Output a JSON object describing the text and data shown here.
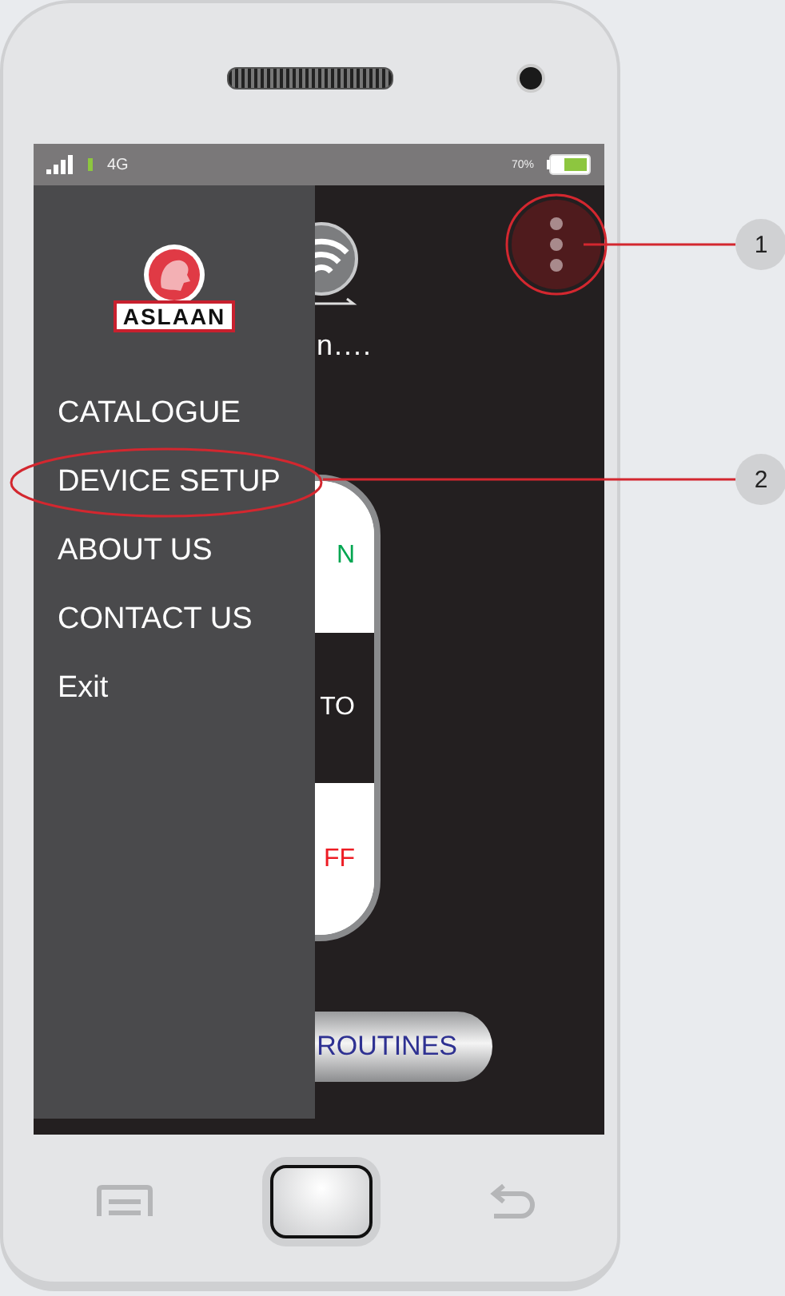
{
  "status_bar": {
    "network": "4G",
    "battery": "70%"
  },
  "drawer": {
    "logo": "ASLAAN",
    "items": [
      {
        "label": "CATALOGUE"
      },
      {
        "label": "DEVICE SETUP"
      },
      {
        "label": "ABOUT US"
      },
      {
        "label": "CONTACT US"
      },
      {
        "label": "Exit"
      }
    ]
  },
  "main": {
    "connection_text": "n....",
    "modes": [
      {
        "label": "N",
        "selected": false,
        "color": "#00a651"
      },
      {
        "label": "TO",
        "selected": true,
        "color": "#ffffff"
      },
      {
        "label": "FF",
        "selected": false,
        "color": "#ed1c24"
      }
    ],
    "routines_button": "ROUTINES"
  },
  "callouts": [
    {
      "number": "1"
    },
    {
      "number": "2"
    }
  ]
}
